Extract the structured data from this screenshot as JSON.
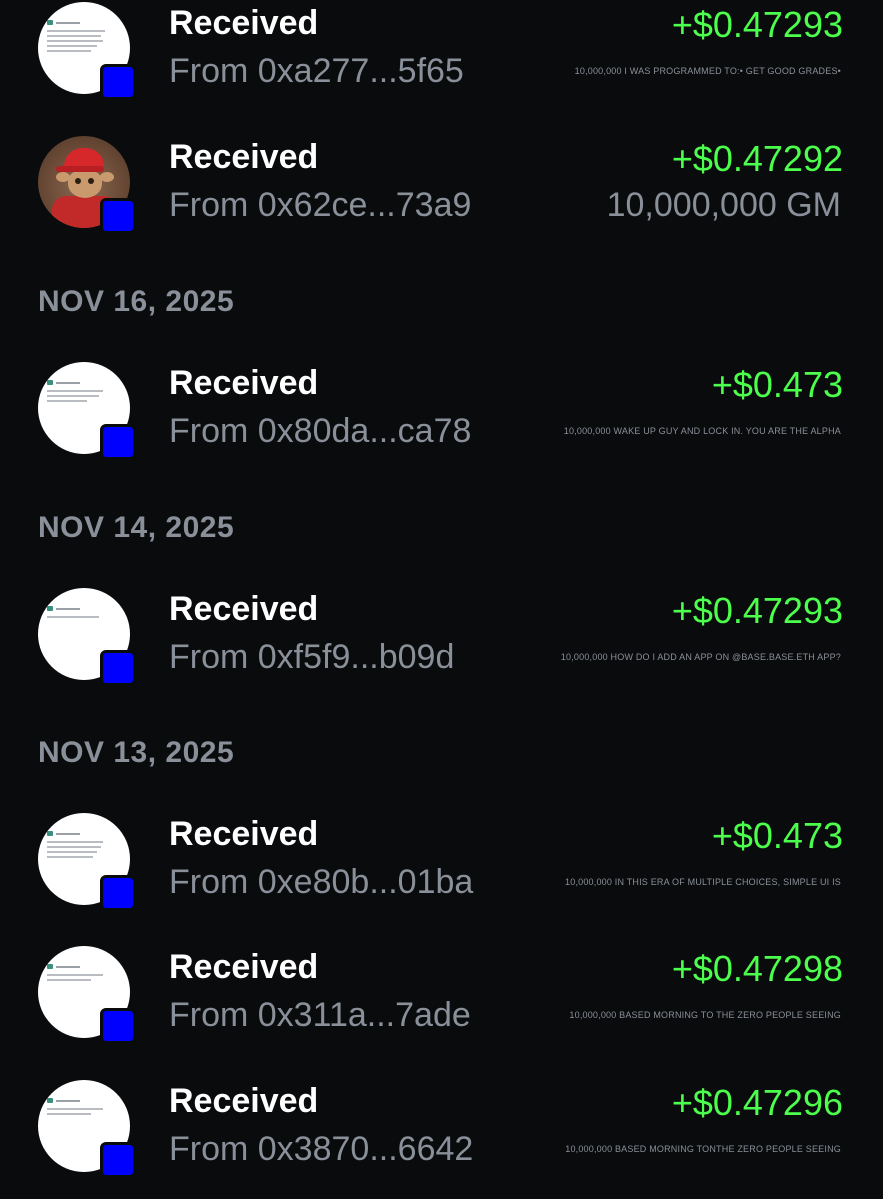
{
  "colors": {
    "background": "#0a0b0d",
    "amount_green": "#4cff4c",
    "secondary_text": "#8a9099",
    "badge_blue": "#0000ff"
  },
  "transactions": [
    {
      "title": "Received",
      "from": "From 0xa277...5f65",
      "amount": "+$0.47293",
      "memo": "10,000,000 I WAS PROGRAMMED TO:• GET GOOD GRADES•",
      "avatar_icon": "document-screenshot-icon"
    },
    {
      "title": "Received",
      "from": "From 0x62ce...73a9",
      "amount": "+$0.47292",
      "memo": "10,000,000 GM",
      "avatar_icon": "kfc-goblin-icon"
    },
    {
      "title": "Received",
      "from": "From 0x80da...ca78",
      "amount": "+$0.473",
      "memo": "10,000,000 WAKE UP GUY AND LOCK IN. YOU ARE THE ALPHA",
      "avatar_icon": "document-screenshot-icon"
    },
    {
      "title": "Received",
      "from": "From 0xf5f9...b09d",
      "amount": "+$0.47293",
      "memo": "10,000,000 HOW DO I ADD AN APP ON @BASE.BASE.ETH APP?",
      "avatar_icon": "document-screenshot-icon"
    },
    {
      "title": "Received",
      "from": "From 0xe80b...01ba",
      "amount": "+$0.473",
      "memo": "10,000,000 IN THIS ERA OF MULTIPLE CHOICES, SIMPLE UI IS",
      "avatar_icon": "document-screenshot-icon"
    },
    {
      "title": "Received",
      "from": "From 0x311a...7ade",
      "amount": "+$0.47298",
      "memo": "10,000,000 BASED MORNING TO THE ZERO PEOPLE SEEING",
      "avatar_icon": "document-screenshot-icon"
    },
    {
      "title": "Received",
      "from": "From 0x3870...6642",
      "amount": "+$0.47296",
      "memo": "10,000,000 BASED MORNING TONTHE ZERO PEOPLE SEEING",
      "avatar_icon": "document-screenshot-icon"
    }
  ],
  "date_headers": [
    "NOV 16, 2025",
    "NOV 14, 2025",
    "NOV 13, 2025"
  ]
}
